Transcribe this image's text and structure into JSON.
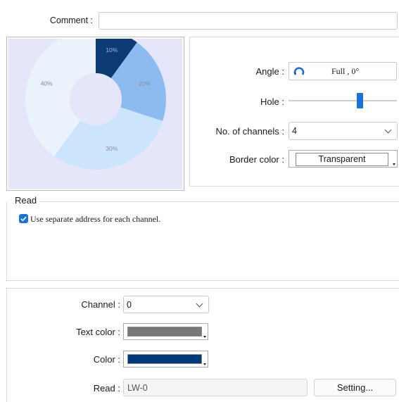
{
  "comment": {
    "label": "Comment :",
    "value": ""
  },
  "chart_data": {
    "type": "pie",
    "style": "donut",
    "values": [
      10,
      20,
      30,
      40
    ],
    "labels": [
      "10%",
      "20%",
      "30%",
      "40%"
    ],
    "colors": [
      "#0b3a75",
      "#8dbbf0",
      "#cde4fd",
      "#eaf2fc"
    ],
    "background": "#e6e6fa",
    "center_color": "#e6e6fa",
    "title": ""
  },
  "angle": {
    "label": "Angle :",
    "value": "Full , 0°"
  },
  "hole": {
    "label": "Hole :",
    "value": 0.66
  },
  "channels": {
    "label": "No. of channels :",
    "value": "4"
  },
  "border_color": {
    "label": "Border color :",
    "value": "Transparent"
  },
  "read_section": {
    "title": "Read",
    "checkbox_label": "Use separate address for each channel.",
    "checked": true
  },
  "channel": {
    "label": "Channel :",
    "value": "0"
  },
  "text_color": {
    "label": "Text color :",
    "color": "#777777"
  },
  "color": {
    "label": "Color :",
    "color": "#003a7a"
  },
  "read": {
    "label": "Read :",
    "value": "LW-0",
    "button": "Setting..."
  }
}
